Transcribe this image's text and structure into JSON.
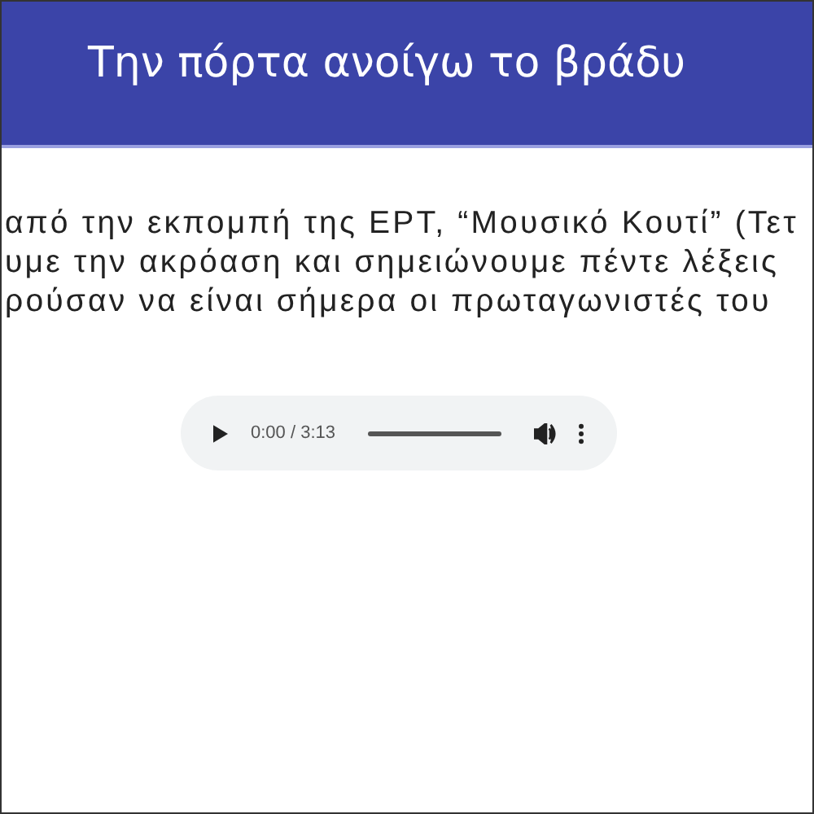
{
  "header": {
    "title": "Την πόρτα ανοίγω το βράδυ"
  },
  "text_lines": [
    "από την εκπομπή της ΕΡΤ, “Μουσικό Κουτί” (Τετ",
    "υμε την ακρόαση και σημειώνουμε πέντε λέξεις",
    "ρούσαν να είναι σήμερα οι πρωταγωνιστές του"
  ],
  "audio_player": {
    "time": "0:00 / 3:13"
  }
}
